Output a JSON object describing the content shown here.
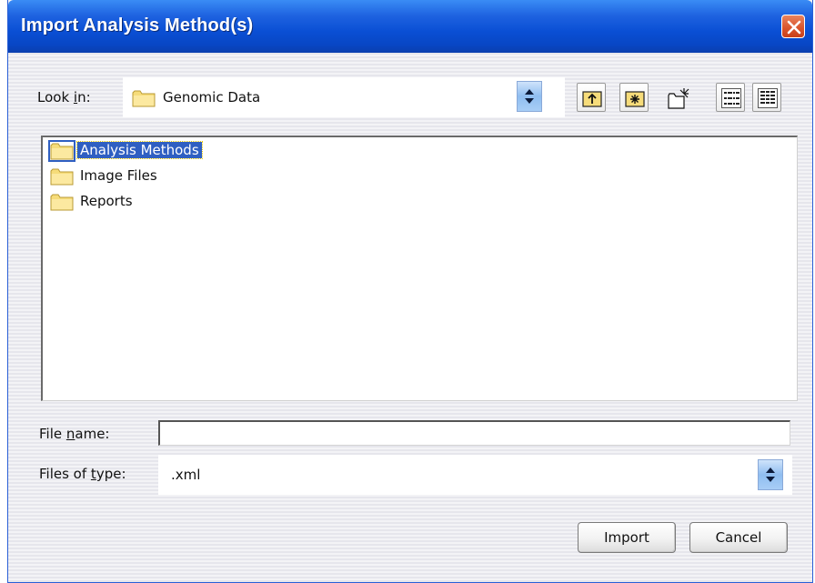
{
  "window": {
    "title": "Import Analysis Method(s)"
  },
  "look_in": {
    "label_pre": "Look ",
    "label_mnemonic": "i",
    "label_post": "n:",
    "value": "Genomic Data"
  },
  "toolbar": [
    "up-one-level",
    "home-folder",
    "new-folder",
    "list-view",
    "details-view"
  ],
  "files": [
    {
      "name": "Analysis Methods",
      "selected": true
    },
    {
      "name": "Image Files",
      "selected": false
    },
    {
      "name": "Reports",
      "selected": false
    }
  ],
  "file_name": {
    "label_pre": "File ",
    "label_mnemonic": "n",
    "label_post": "ame:",
    "value": ""
  },
  "file_type": {
    "label_pre": "Files of ",
    "label_mnemonic": "t",
    "label_post": "ype:",
    "value": ".xml"
  },
  "buttons": {
    "import": "Import",
    "cancel": "Cancel"
  },
  "colors": {
    "titlebar": "#0a4fd4",
    "selection": "#2f5fc2",
    "close": "#d9532b"
  }
}
